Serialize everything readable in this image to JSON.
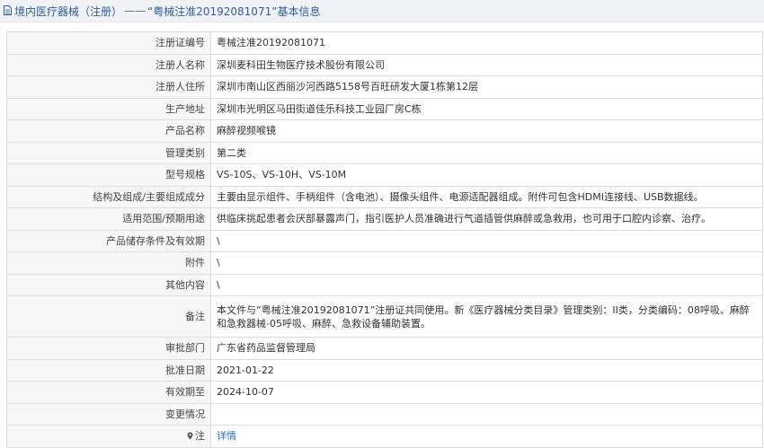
{
  "header": {
    "section": "境内医疗器械（注册）",
    "separator": "——",
    "reg_number_quoted": "“粤械注准20192081071”",
    "suffix": "基本信息"
  },
  "rows": [
    {
      "label": "注册证编号",
      "value": "粤械注准20192081071"
    },
    {
      "label": "注册人名称",
      "value": "深圳麦科田生物医疗技术股份有限公司"
    },
    {
      "label": "注册人住所",
      "value": "深圳市南山区西丽沙河西路5158号百旺研发大厦1栋第12层"
    },
    {
      "label": "生产地址",
      "value": "深圳市光明区马田街道佳乐科技工业园厂房C栋"
    },
    {
      "label": "产品名称",
      "value": "麻醉视频喉镜"
    },
    {
      "label": "管理类别",
      "value": "第二类"
    },
    {
      "label": "型号规格",
      "value": "VS-10S、VS-10H、VS-10M"
    },
    {
      "label": "结构及组成/主要组成成分",
      "value": "主要由显示组件、手柄组件（含电池）、摄像头组件、电源适配器组成。附件可包含HDMI连接线、USB数据线。"
    },
    {
      "label": "适用范围/预期用途",
      "value": "供临床挑起患者会厌部暴露声门，指引医护人员准确进行气道插管供麻醉或急救用，也可用于口腔内诊察、治疗。"
    },
    {
      "label": "产品储存条件及有效期",
      "value": "\\"
    },
    {
      "label": "附件",
      "value": "\\"
    },
    {
      "label": "其他内容",
      "value": "\\"
    },
    {
      "label": "备注",
      "value": "本文件与“粤械注准20192081071”注册证共同使用。新《医疗器械分类目录》管理类别：II类，分类编码：08呼吸、麻醉和急救器械-05呼吸、麻醉、急救设备辅助装置。"
    },
    {
      "label": "审批部门",
      "value": "广东省药品监督管理局"
    },
    {
      "label": "批准日期",
      "value": "2021-01-22"
    },
    {
      "label": "有效期至",
      "value": "2024-10-07"
    },
    {
      "label": "变更情况",
      "value": ""
    }
  ],
  "note_row": {
    "label": "注",
    "link_text": "详情"
  }
}
